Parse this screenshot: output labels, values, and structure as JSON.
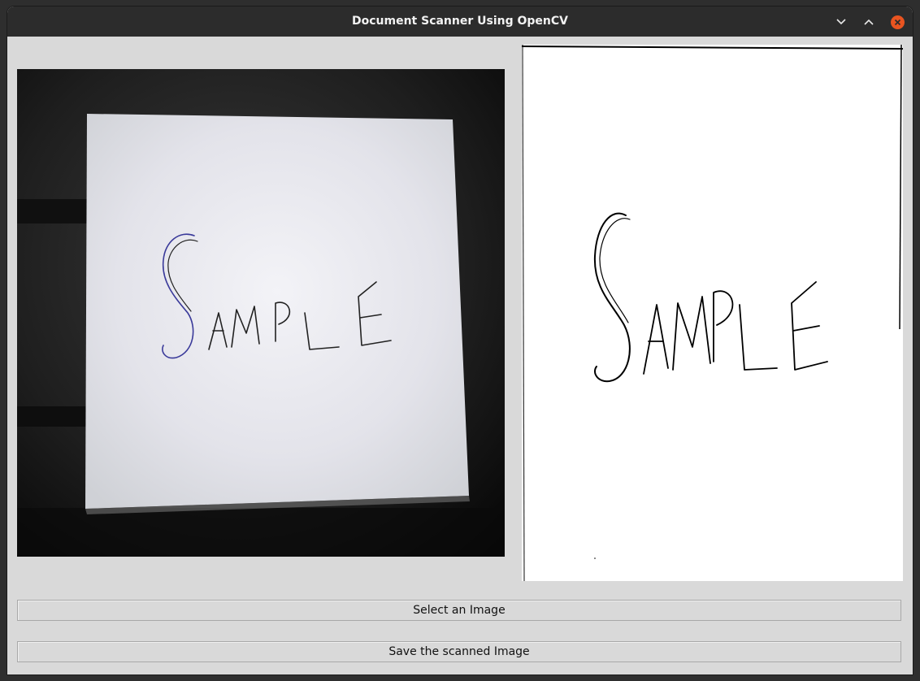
{
  "window": {
    "title": "Document Scanner Using OpenCV"
  },
  "titlebar_controls": {
    "minimize_icon": "chevron-down-icon",
    "maximize_icon": "chevron-up-icon",
    "close_icon": "close-icon",
    "close_color": "#e95420"
  },
  "original_image": {
    "handwritten_text": "SAMPLE"
  },
  "scanned_image": {
    "handwritten_text": "SAMPLE"
  },
  "buttons": {
    "select_label": "Select an Image",
    "save_label": "Save the scanned Image"
  }
}
